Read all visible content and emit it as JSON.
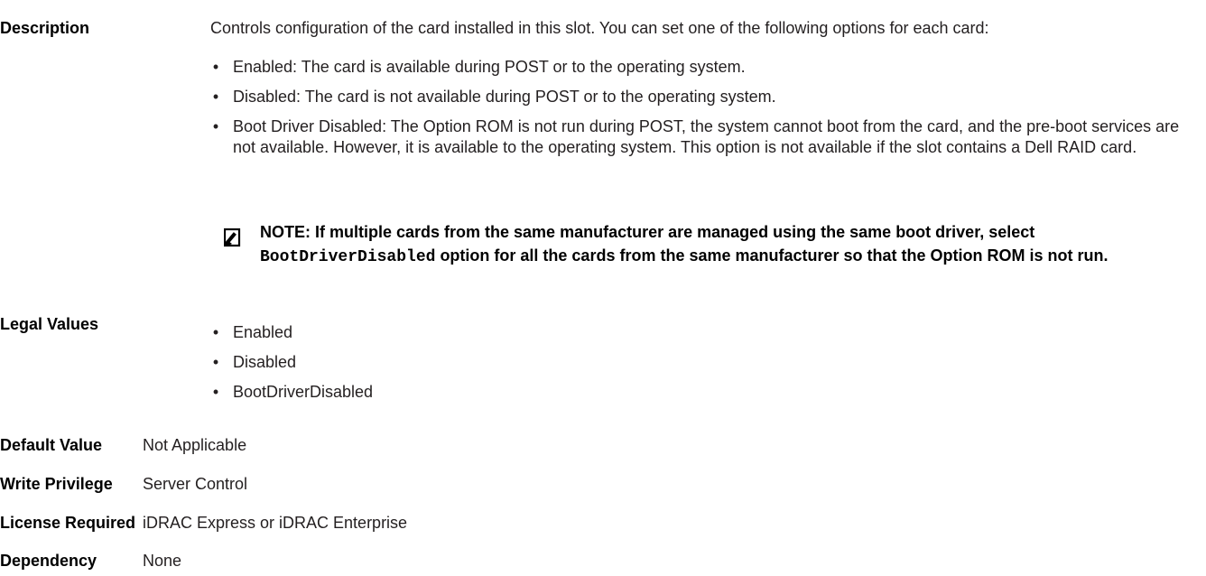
{
  "rows": {
    "description": {
      "label": "Description",
      "text": "Controls configuration of the card installed in this slot. You can set one of the following options for each card:",
      "bullets": [
        "Enabled: The card is available during POST or to the operating system.",
        "Disabled: The card is not available during POST or to the operating system.",
        "Boot Driver Disabled: The Option ROM is not run during POST, the system cannot boot from the card, and the pre-boot services are not available. However, it is available to the operating system. This option is not available if the slot contains a Dell RAID card."
      ],
      "note": {
        "prefix": "NOTE: If multiple cards from the same manufacturer are managed using the same boot driver, select ",
        "code": "BootDriverDisabled",
        "suffix": " option for all the cards from the same manufacturer so that the Option ROM is not run.",
        "icon": "note-pencil-icon"
      }
    },
    "legal_values": {
      "label": "Legal Values",
      "items": [
        "Enabled",
        "Disabled",
        "BootDriverDisabled"
      ]
    },
    "default_value": {
      "label": "Default Value",
      "value": "Not Applicable"
    },
    "write_privilege": {
      "label": "Write Privilege",
      "value": "Server Control"
    },
    "license_required": {
      "label": "License Required",
      "value": "iDRAC Express or iDRAC Enterprise"
    },
    "dependency": {
      "label": "Dependency",
      "value": "None"
    }
  }
}
